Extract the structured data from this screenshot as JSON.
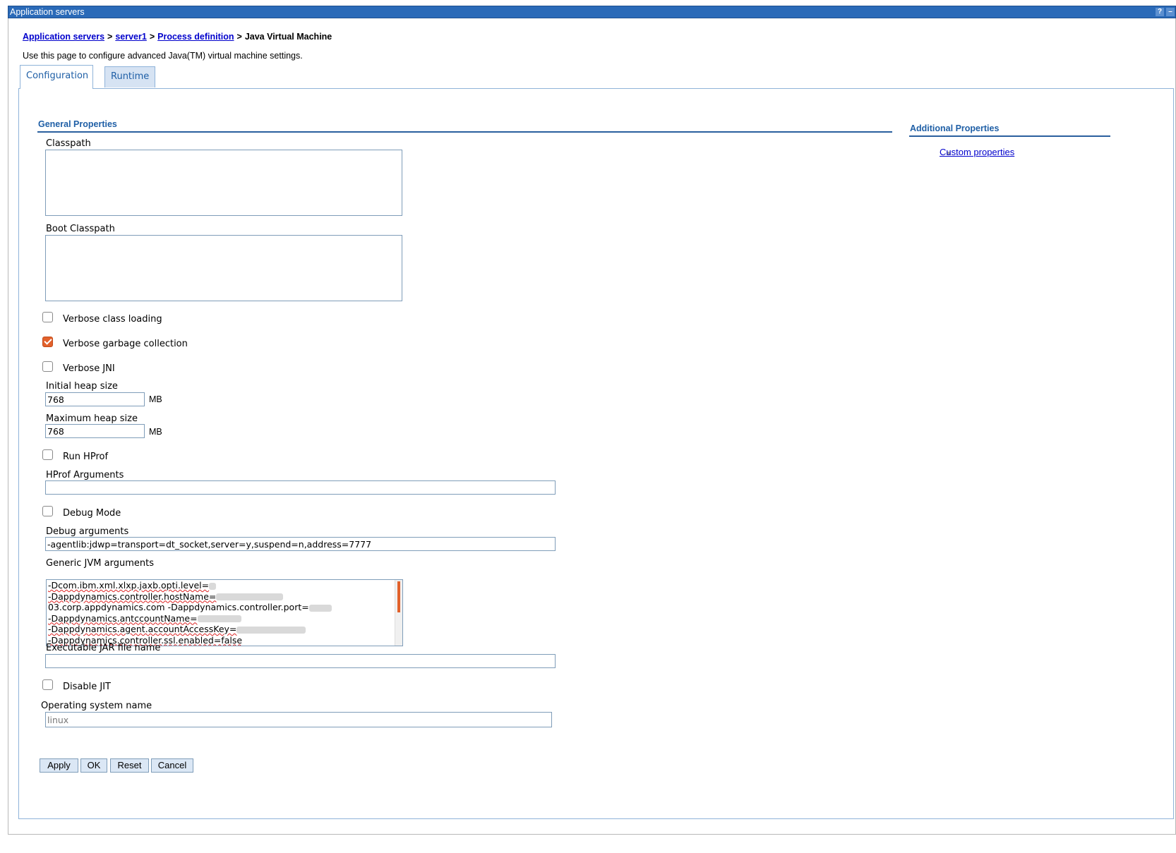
{
  "window": {
    "title": "Application servers",
    "help_label": "?",
    "minimize_label": "–"
  },
  "breadcrumb": {
    "items": [
      {
        "label": "Application servers"
      },
      {
        "label": "server1"
      },
      {
        "label": "Process definition"
      }
    ],
    "separator": ">",
    "current": "Java Virtual Machine"
  },
  "description": "Use this page to configure advanced Java(TM) virtual machine settings.",
  "tabs": [
    {
      "label": "Configuration",
      "active": true
    },
    {
      "label": "Runtime",
      "active": false
    }
  ],
  "general": {
    "title": "General Properties",
    "classpath": {
      "label": "Classpath",
      "value": ""
    },
    "boot_classpath": {
      "label": "Boot Classpath",
      "value": ""
    },
    "verbose_class_loading": {
      "label": "Verbose class loading",
      "checked": false
    },
    "verbose_gc": {
      "label": "Verbose garbage collection",
      "checked": true
    },
    "verbose_jni": {
      "label": "Verbose JNI",
      "checked": false
    },
    "initial_heap": {
      "label": "Initial heap size",
      "value": "768",
      "unit": "MB"
    },
    "max_heap": {
      "label": "Maximum heap size",
      "value": "768",
      "unit": "MB"
    },
    "run_hprof": {
      "label": "Run HProf",
      "checked": false
    },
    "hprof_args": {
      "label": "HProf Arguments",
      "value": ""
    },
    "debug_mode": {
      "label": "Debug Mode",
      "checked": false
    },
    "debug_args": {
      "label": "Debug arguments",
      "value": "-agentlib:jdwp=transport=dt_socket,server=y,suspend=n,address=7777"
    },
    "generic_jvm": {
      "label": "Generic JVM arguments",
      "lines": [
        "-Dcom.ibm.xml.xlxp.jaxb.opti.level=",
        "-Dappdynamics.controller.hostName=",
        "03.corp.appdynamics.com -Dappdynamics.controller.port=",
        "-Dappdynamics.antccountName=",
        "-Dappdynamics.agent.accountAccessKey=",
        "-Dappdynamics.controller.ssl.enabled=false"
      ]
    },
    "exec_jar": {
      "label": "Executable JAR file name",
      "value": ""
    },
    "disable_jit": {
      "label": "Disable JIT",
      "checked": false
    },
    "os_name": {
      "label": "Operating system name",
      "value": "linux"
    }
  },
  "additional": {
    "title": "Additional Properties",
    "links": [
      {
        "label": "Custom properties"
      }
    ]
  },
  "buttons": {
    "apply": "Apply",
    "ok": "OK",
    "reset": "Reset",
    "cancel": "Cancel"
  },
  "colors": {
    "titlebar": "#2a6ab8",
    "link": "#0000cc",
    "section": "#1f5fa6",
    "checkbox_checked": "#e2612b"
  }
}
